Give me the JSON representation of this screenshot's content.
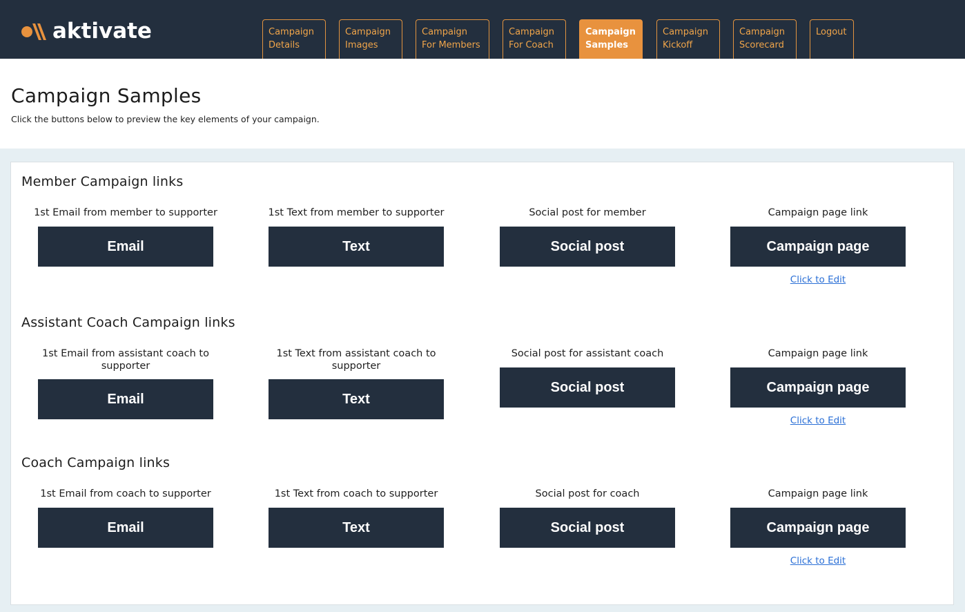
{
  "brand": {
    "name": "aktivate",
    "accent": "#e8923e",
    "navy": "#232f3e"
  },
  "nav": {
    "tabs": [
      {
        "label": "Campaign\nDetails",
        "active": false
      },
      {
        "label": "Campaign\nImages",
        "active": false
      },
      {
        "label": "Campaign\nFor Members",
        "active": false
      },
      {
        "label": "Campaign\nFor Coach",
        "active": false
      },
      {
        "label": "Campaign\nSamples",
        "active": true
      },
      {
        "label": "Campaign\nKickoff",
        "active": false
      },
      {
        "label": "Campaign\nScorecard",
        "active": false
      },
      {
        "label": "Logout",
        "active": false
      }
    ]
  },
  "page": {
    "title": "Campaign Samples",
    "subtitle": "Click the buttons below to preview the key elements of your campaign."
  },
  "sections": [
    {
      "title": "Member Campaign links",
      "columns": [
        {
          "label": "1st Email from member to supporter",
          "button": "Email"
        },
        {
          "label": "1st Text from member to supporter",
          "button": "Text"
        },
        {
          "label": "Social post for member",
          "button": "Social post"
        },
        {
          "label": "Campaign page link",
          "button": "Campaign page",
          "link": "Click to Edit"
        }
      ]
    },
    {
      "title": "Assistant Coach Campaign links",
      "columns": [
        {
          "label": "1st Email from assistant coach to supporter",
          "button": "Email"
        },
        {
          "label": "1st Text from assistant coach to supporter",
          "button": "Text"
        },
        {
          "label": "Social post for assistant coach",
          "button": "Social post"
        },
        {
          "label": "Campaign page link",
          "button": "Campaign page",
          "link": "Click to Edit"
        }
      ]
    },
    {
      "title": "Coach Campaign links",
      "columns": [
        {
          "label": "1st Email from coach to supporter",
          "button": "Email"
        },
        {
          "label": "1st Text from coach to supporter",
          "button": "Text"
        },
        {
          "label": "Social post for coach",
          "button": "Social post"
        },
        {
          "label": "Campaign page link",
          "button": "Campaign page",
          "link": "Click to Edit"
        }
      ]
    }
  ]
}
